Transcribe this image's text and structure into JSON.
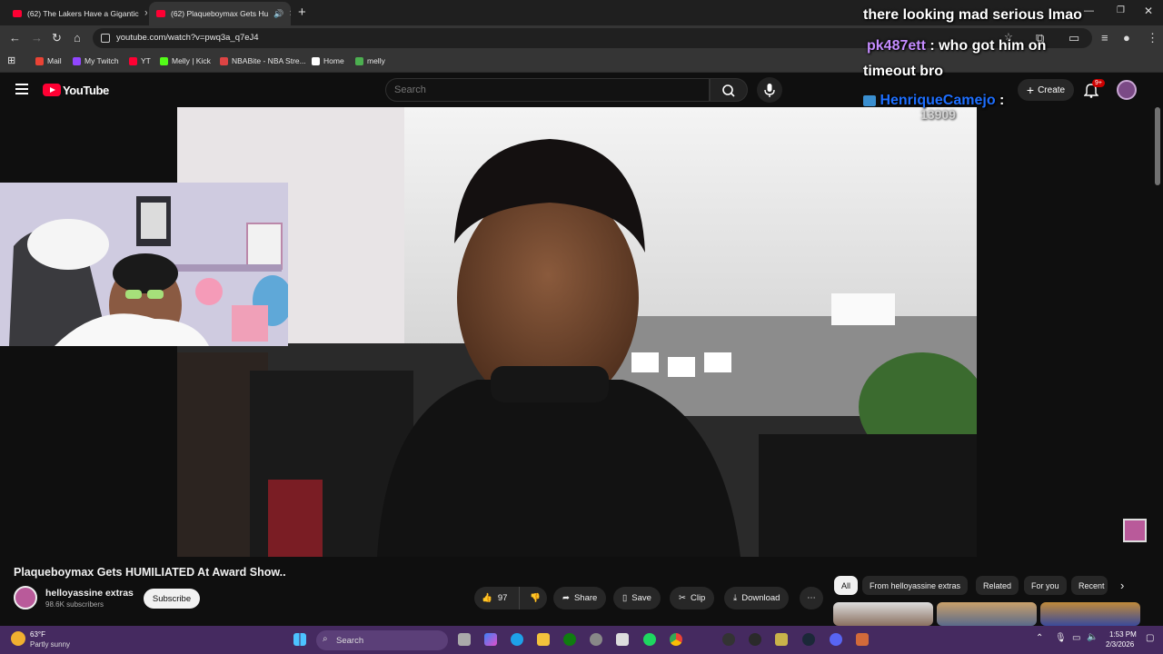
{
  "browser": {
    "tabs": [
      {
        "label": "(62) The Lakers Have a Gigantic"
      },
      {
        "label": "(62) Plaqueboymax Gets Hu"
      }
    ],
    "url": "youtube.com/watch?v=pwq3a_q7eJ4",
    "bookmarks": [
      {
        "label": "Mail",
        "color": "#ea4335"
      },
      {
        "label": "My Twitch",
        "color": "#9146ff"
      },
      {
        "label": "YT",
        "color": "#ff0033"
      },
      {
        "label": "Melly | Kick",
        "color": "#53fc18"
      },
      {
        "label": "NBABite - NBA Stre...",
        "color": "#d44"
      },
      {
        "label": "Home",
        "color": "#ffffff"
      },
      {
        "label": "melly",
        "color": "#4caf50"
      }
    ]
  },
  "youtube": {
    "logo": "YouTube",
    "search_placeholder": "Search",
    "create_label": "Create",
    "notif_count": "9+"
  },
  "chat": {
    "line1": "there looking mad serious lmao",
    "user2": "pk487ett",
    "msg2": ": who got him on",
    "msg2b": "timeout bro",
    "user3": "HenriqueCamejo",
    "msg3": ":",
    "overlay_number": "13909",
    "user2_color": "#c58cff",
    "user3_color": "#1e6fff"
  },
  "video": {
    "title": "Plaqueboymax Gets HUMILIATED At Award Show..",
    "channel": "helloyassine extras",
    "subscribers": "98.6K subscribers",
    "subscribe_label": "Subscribe",
    "likes": "97",
    "share_label": "Share",
    "save_label": "Save",
    "clip_label": "Clip",
    "download_label": "Download"
  },
  "chips": [
    "All",
    "From helloyassine extras",
    "Related",
    "For you",
    "Recent"
  ],
  "taskbar": {
    "weather_temp": "63°F",
    "weather_desc": "Partly sunny",
    "search_label": "Search",
    "time": "1:53 PM",
    "date": "2/3/2026"
  }
}
